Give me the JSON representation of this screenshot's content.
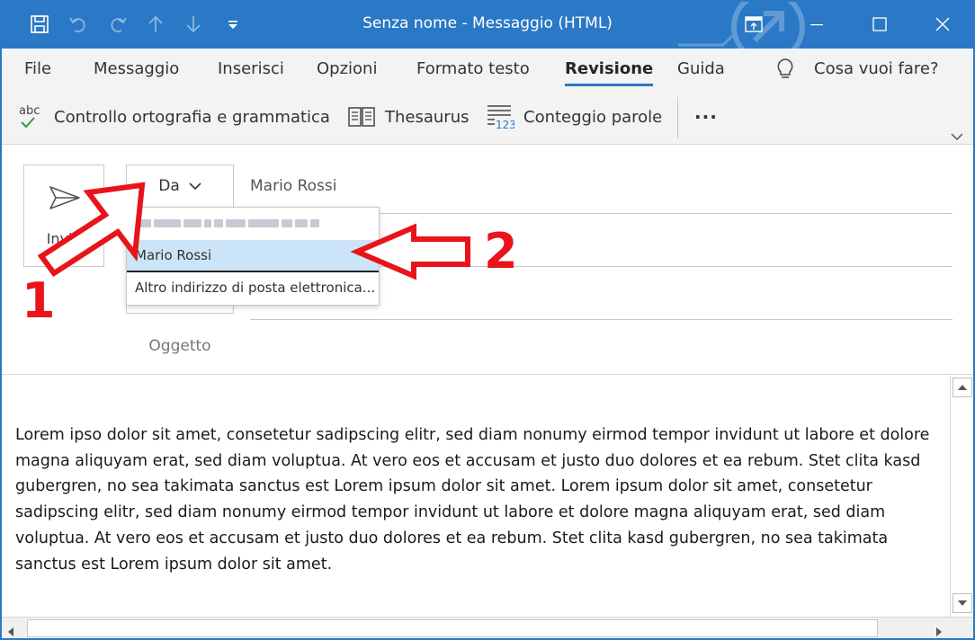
{
  "window": {
    "title": "Senza nome  -  Messaggio (HTML)",
    "accent_color": "#2B78C6"
  },
  "menu": {
    "tabs": [
      "File",
      "Messaggio",
      "Inserisci",
      "Opzioni",
      "Formato testo",
      "Revisione",
      "Guida"
    ],
    "active_tab": "Revisione",
    "tell_me": "Cosa vuoi fare?"
  },
  "ribbon": {
    "spelling": "Controllo ortografia e grammatica",
    "spelling_icon_text": "abc",
    "thesaurus": "Thesaurus",
    "word_count": "Conteggio parole",
    "word_count_icon_text": "123",
    "more": "···"
  },
  "header": {
    "send_label": "Invia",
    "from_button": "Da",
    "from_value": "Mario Rossi",
    "subject_label": "Oggetto"
  },
  "dropdown": {
    "items": [
      "Mario Rossi",
      "Altro indirizzo di posta elettronica..."
    ],
    "selected": "Mario Rossi"
  },
  "annotations": {
    "first": "1",
    "second": "2",
    "color": "#E8141A"
  },
  "message": {
    "body": "Lorem ipso dolor sit amet, consetetur sadipscing elitr, sed diam nonumy eirmod tempor invidunt ut labore et dolore magna aliquyam erat, sed diam voluptua. At vero eos et accusam et justo duo dolores et ea rebum. Stet clita kasd gubergren, no sea takimata sanctus est Lorem ipsum dolor sit amet. Lorem ipsum dolor sit amet, consetetur sadipscing elitr, sed diam nonumy eirmod tempor invidunt ut labore et dolore magna aliquyam erat, sed diam voluptua. At vero eos et accusam et justo duo dolores et ea rebum. Stet clita kasd gubergren, no sea takimata sanctus est Lorem ipsum dolor sit amet."
  }
}
